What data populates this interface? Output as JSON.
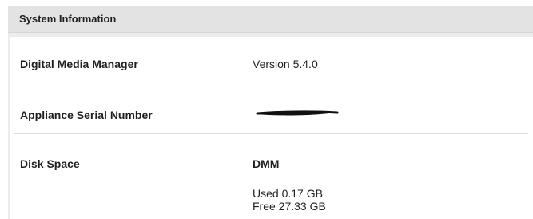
{
  "panel": {
    "title": "System Information"
  },
  "rows": [
    {
      "label": "Digital Media Manager",
      "value": "Version 5.4.0"
    },
    {
      "label": "Appliance Serial Number",
      "value_redacted": true
    },
    {
      "label": "Disk Space",
      "value_heading": "DMM",
      "used": "Used 0.17 GB",
      "free": "Free 27.33 GB"
    }
  ],
  "colors": {
    "header_bg": "#e3e3e3",
    "panel_bg": "#ececec",
    "divider": "#dedede",
    "text": "#1f1f1f",
    "redaction": "#111111"
  }
}
